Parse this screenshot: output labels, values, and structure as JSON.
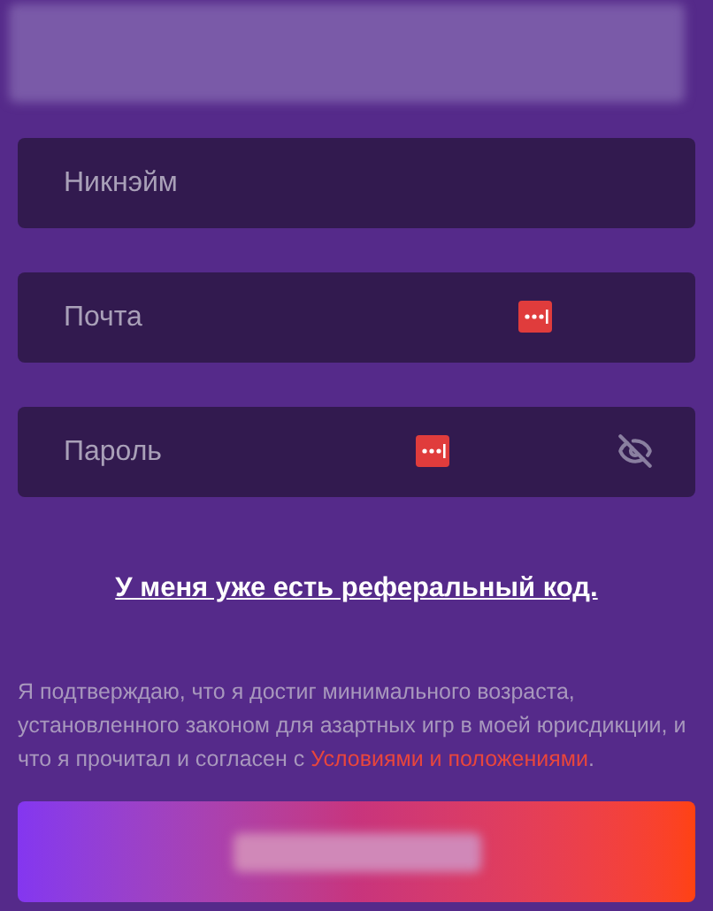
{
  "fields": [
    {
      "placeholder": "Никнэйм",
      "manager_icon": false,
      "toggle_visibility": false
    },
    {
      "placeholder": "Почта",
      "manager_icon": true,
      "toggle_visibility": false
    },
    {
      "placeholder": "Пароль",
      "manager_icon": true,
      "toggle_visibility": true
    }
  ],
  "referral_link": "У меня уже есть реферальный код.",
  "consent": {
    "text": "Я подтверждаю, что я достиг минимального возраста, установленного законом для азартных игр в моей юрисдикции, и что я прочитал и согласен с ",
    "link": "Условиями и положениями",
    "end": "."
  }
}
